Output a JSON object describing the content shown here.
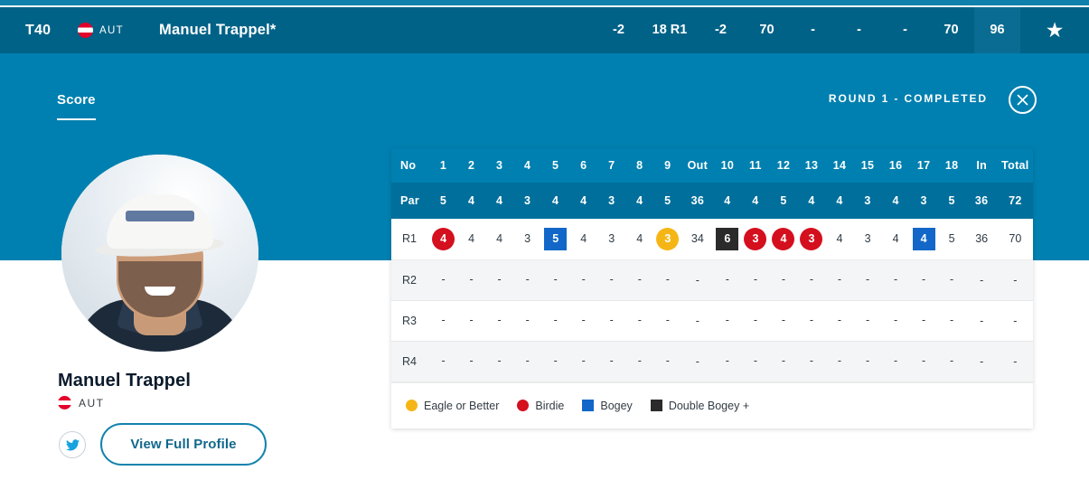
{
  "header": {
    "position": "T40",
    "country_code": "AUT",
    "flag": "austria-flag-icon",
    "player_name": "Manuel Trappel*",
    "stats": [
      {
        "name": "to-par",
        "value": "-2"
      },
      {
        "name": "thru",
        "value": "18 R1"
      },
      {
        "name": "today",
        "value": "-2"
      },
      {
        "name": "round-1",
        "value": "70"
      },
      {
        "name": "round-2",
        "value": "-"
      },
      {
        "name": "round-3",
        "value": "-"
      },
      {
        "name": "round-4",
        "value": "-"
      },
      {
        "name": "total",
        "value": "70"
      },
      {
        "name": "points",
        "value": "96",
        "highlighted": true
      }
    ],
    "favourite_icon": "star-icon"
  },
  "panel": {
    "tab_label": "Score",
    "round_status": "ROUND 1 - COMPLETED",
    "close_icon": "close-icon"
  },
  "profile": {
    "avatar": "player-photo",
    "name": "Manuel Trappel",
    "country_code": "AUT",
    "flag": "austria-flag-icon",
    "twitter_icon": "twitter-icon",
    "view_profile_label": "View Full Profile"
  },
  "scorecard": {
    "row_label_header": "No",
    "par_label": "Par",
    "holes": [
      "1",
      "2",
      "3",
      "4",
      "5",
      "6",
      "7",
      "8",
      "9"
    ],
    "out_label": "Out",
    "holes_back": [
      "10",
      "11",
      "12",
      "13",
      "14",
      "15",
      "16",
      "17",
      "18"
    ],
    "in_label": "In",
    "total_label": "Total",
    "par_front": [
      "5",
      "4",
      "4",
      "3",
      "4",
      "4",
      "3",
      "4",
      "5"
    ],
    "par_out": "36",
    "par_back": [
      "4",
      "4",
      "5",
      "4",
      "4",
      "3",
      "4",
      "3",
      "5"
    ],
    "par_in": "36",
    "par_total": "72",
    "rounds": [
      {
        "label": "R1",
        "front": [
          {
            "v": "4",
            "t": "birdie"
          },
          {
            "v": "4",
            "t": "plain"
          },
          {
            "v": "4",
            "t": "plain"
          },
          {
            "v": "3",
            "t": "plain"
          },
          {
            "v": "5",
            "t": "bogey"
          },
          {
            "v": "4",
            "t": "plain"
          },
          {
            "v": "3",
            "t": "plain"
          },
          {
            "v": "4",
            "t": "plain"
          },
          {
            "v": "3",
            "t": "eagle"
          }
        ],
        "out": "34",
        "back": [
          {
            "v": "6",
            "t": "dbogey"
          },
          {
            "v": "3",
            "t": "birdie"
          },
          {
            "v": "4",
            "t": "birdie"
          },
          {
            "v": "3",
            "t": "birdie"
          },
          {
            "v": "4",
            "t": "plain"
          },
          {
            "v": "3",
            "t": "plain"
          },
          {
            "v": "4",
            "t": "plain"
          },
          {
            "v": "4",
            "t": "bogey"
          },
          {
            "v": "5",
            "t": "plain"
          }
        ],
        "in": "36",
        "total": "70"
      },
      {
        "label": "R2",
        "front": [
          {
            "v": "-",
            "t": "plain"
          },
          {
            "v": "-",
            "t": "plain"
          },
          {
            "v": "-",
            "t": "plain"
          },
          {
            "v": "-",
            "t": "plain"
          },
          {
            "v": "-",
            "t": "plain"
          },
          {
            "v": "-",
            "t": "plain"
          },
          {
            "v": "-",
            "t": "plain"
          },
          {
            "v": "-",
            "t": "plain"
          },
          {
            "v": "-",
            "t": "plain"
          }
        ],
        "out": "-",
        "back": [
          {
            "v": "-",
            "t": "plain"
          },
          {
            "v": "-",
            "t": "plain"
          },
          {
            "v": "-",
            "t": "plain"
          },
          {
            "v": "-",
            "t": "plain"
          },
          {
            "v": "-",
            "t": "plain"
          },
          {
            "v": "-",
            "t": "plain"
          },
          {
            "v": "-",
            "t": "plain"
          },
          {
            "v": "-",
            "t": "plain"
          },
          {
            "v": "-",
            "t": "plain"
          }
        ],
        "in": "-",
        "total": "-"
      },
      {
        "label": "R3",
        "front": [
          {
            "v": "-",
            "t": "plain"
          },
          {
            "v": "-",
            "t": "plain"
          },
          {
            "v": "-",
            "t": "plain"
          },
          {
            "v": "-",
            "t": "plain"
          },
          {
            "v": "-",
            "t": "plain"
          },
          {
            "v": "-",
            "t": "plain"
          },
          {
            "v": "-",
            "t": "plain"
          },
          {
            "v": "-",
            "t": "plain"
          },
          {
            "v": "-",
            "t": "plain"
          }
        ],
        "out": "-",
        "back": [
          {
            "v": "-",
            "t": "plain"
          },
          {
            "v": "-",
            "t": "plain"
          },
          {
            "v": "-",
            "t": "plain"
          },
          {
            "v": "-",
            "t": "plain"
          },
          {
            "v": "-",
            "t": "plain"
          },
          {
            "v": "-",
            "t": "plain"
          },
          {
            "v": "-",
            "t": "plain"
          },
          {
            "v": "-",
            "t": "plain"
          },
          {
            "v": "-",
            "t": "plain"
          }
        ],
        "in": "-",
        "total": "-"
      },
      {
        "label": "R4",
        "front": [
          {
            "v": "-",
            "t": "plain"
          },
          {
            "v": "-",
            "t": "plain"
          },
          {
            "v": "-",
            "t": "plain"
          },
          {
            "v": "-",
            "t": "plain"
          },
          {
            "v": "-",
            "t": "plain"
          },
          {
            "v": "-",
            "t": "plain"
          },
          {
            "v": "-",
            "t": "plain"
          },
          {
            "v": "-",
            "t": "plain"
          },
          {
            "v": "-",
            "t": "plain"
          }
        ],
        "out": "-",
        "back": [
          {
            "v": "-",
            "t": "plain"
          },
          {
            "v": "-",
            "t": "plain"
          },
          {
            "v": "-",
            "t": "plain"
          },
          {
            "v": "-",
            "t": "plain"
          },
          {
            "v": "-",
            "t": "plain"
          },
          {
            "v": "-",
            "t": "plain"
          },
          {
            "v": "-",
            "t": "plain"
          },
          {
            "v": "-",
            "t": "plain"
          },
          {
            "v": "-",
            "t": "plain"
          }
        ],
        "in": "-",
        "total": "-"
      }
    ],
    "legend": [
      {
        "label": "Eagle or Better",
        "shape": "circle",
        "color": "#f5b615"
      },
      {
        "label": "Birdie",
        "shape": "circle",
        "color": "#d40f1e"
      },
      {
        "label": "Bogey",
        "shape": "square",
        "color": "#1267c8"
      },
      {
        "label": "Double Bogey +",
        "shape": "square",
        "color": "#2b2b2b"
      }
    ]
  },
  "colors": {
    "brand_blue": "#0080b0",
    "header_blue": "#006287",
    "par_row_blue": "#006f9b",
    "eagle": "#f5b615",
    "birdie": "#d40f1e",
    "bogey": "#1267c8",
    "double_bogey": "#2b2b2b",
    "button_outline": "#1383ac"
  }
}
